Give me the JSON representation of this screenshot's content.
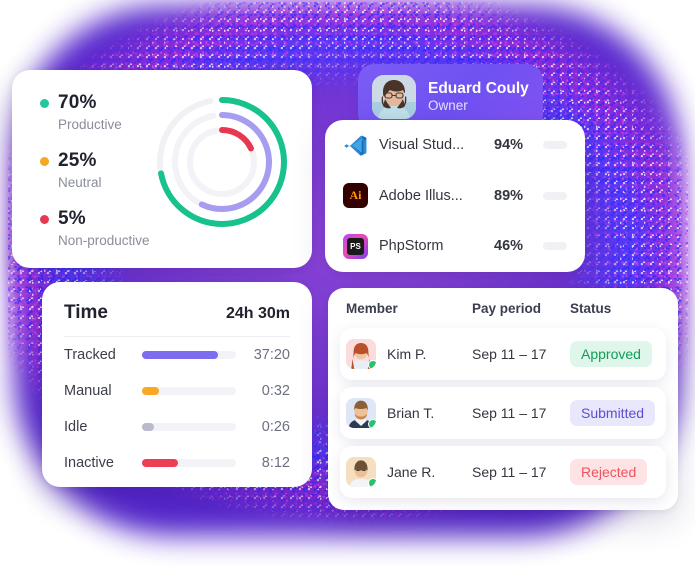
{
  "productivity": {
    "items": [
      {
        "pct": "70%",
        "label": "Productive",
        "color": "#20c997",
        "value": 70
      },
      {
        "pct": "25%",
        "label": "Neutral",
        "color": "#f5a623",
        "value": 25
      },
      {
        "pct": "5%",
        "label": "Non-productive",
        "color": "#e8384f",
        "value": 5
      }
    ],
    "donut": {
      "arcs": [
        {
          "name": "productive",
          "color": "#17c28c",
          "track": "#f1f1f5",
          "radius": 62,
          "sweep_pct": 72
        },
        {
          "name": "neutral",
          "color": "#a79df0",
          "track": "#f2f2f7",
          "radius": 47,
          "sweep_pct": 57
        },
        {
          "name": "non-productive",
          "color": "#e8384f",
          "track": "#f2f2f7",
          "radius": 32,
          "sweep_pct": 18
        }
      ]
    }
  },
  "profile": {
    "name": "Eduard Couly",
    "role": "Owner",
    "avatar_name": "eduard-couly-avatar",
    "background_color": "#7353f3"
  },
  "apps": {
    "rows": [
      {
        "icon": "visual-studio-code-icon",
        "name": "Visual Stud...",
        "pct": "94%",
        "value": 94,
        "bar_color": "#18c78d"
      },
      {
        "icon": "adobe-illustrator-icon",
        "name": "Adobe Illus...",
        "pct": "89%",
        "value": 89,
        "bar_color": "#18c78d"
      },
      {
        "icon": "phpstorm-icon",
        "name": "PhpStorm",
        "pct": "46%",
        "value": 46,
        "bar_color": "#f9a825"
      }
    ]
  },
  "time": {
    "title": "Time",
    "total": "24h 30m",
    "rows": [
      {
        "label": "Tracked",
        "value": "37:20",
        "fill_pct": 81,
        "color": "#7b6cf0"
      },
      {
        "label": "Manual",
        "value": "0:32",
        "fill_pct": 18,
        "color": "#f9a825"
      },
      {
        "label": "Idle",
        "value": "0:26",
        "fill_pct": 13,
        "color": "#b9bace"
      },
      {
        "label": "Inactive",
        "value": "8:12",
        "fill_pct": 38,
        "color": "#ed3f54"
      }
    ]
  },
  "members": {
    "columns": [
      "Member",
      "Pay period",
      "Status"
    ],
    "rows": [
      {
        "name": "Kim P.",
        "period": "Sep 11 – 17",
        "status": "Approved",
        "status_bg": "#dff6ea",
        "status_fg": "#0f9d58",
        "avatar_bg": "#fbdcdc",
        "avatar_name": "kim-p-avatar"
      },
      {
        "name": "Brian T.",
        "period": "Sep 11 – 17",
        "status": "Submitted",
        "status_bg": "#e9e7fb",
        "status_fg": "#5a4fd0",
        "avatar_bg": "#dfe6f7",
        "avatar_name": "brian-t-avatar"
      },
      {
        "name": "Jane R.",
        "period": "Sep 11 – 17",
        "status": "Rejected",
        "status_bg": "#fde3e3",
        "status_fg": "#f0515f",
        "avatar_bg": "#f6dfc0",
        "avatar_name": "jane-r-avatar"
      }
    ]
  }
}
